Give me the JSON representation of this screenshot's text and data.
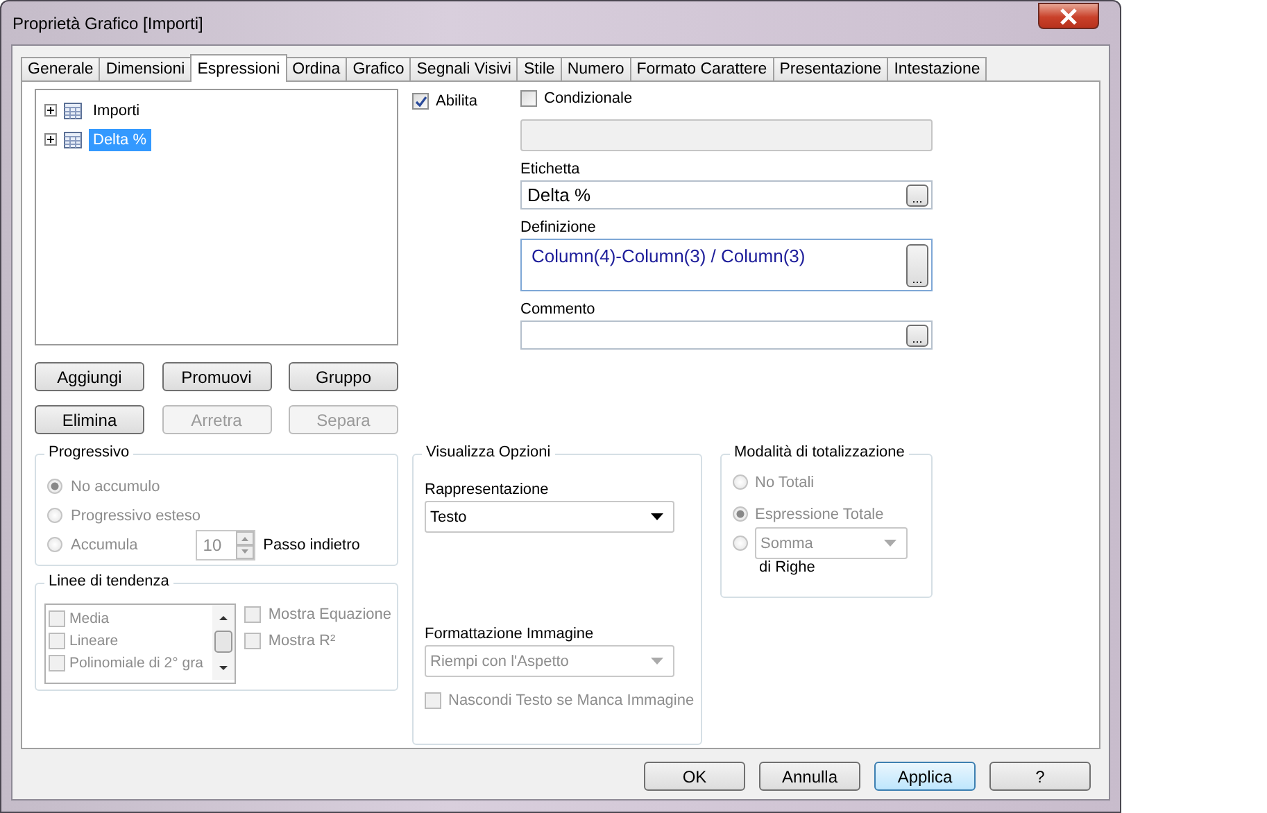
{
  "window": {
    "title": "Proprietà Grafico [Importi]"
  },
  "tabs": [
    {
      "label": "Generale",
      "selected": false
    },
    {
      "label": "Dimensioni",
      "selected": false
    },
    {
      "label": "Espressioni",
      "selected": true
    },
    {
      "label": "Ordina",
      "selected": false
    },
    {
      "label": "Grafico",
      "selected": false
    },
    {
      "label": "Segnali Visivi",
      "selected": false
    },
    {
      "label": "Stile",
      "selected": false
    },
    {
      "label": "Numero",
      "selected": false
    },
    {
      "label": "Formato Carattere",
      "selected": false
    },
    {
      "label": "Presentazione",
      "selected": false
    },
    {
      "label": "Intestazione",
      "selected": false
    }
  ],
  "expressions": [
    {
      "label": "Importi",
      "selected": false
    },
    {
      "label": "Delta %",
      "selected": true
    }
  ],
  "expression_buttons": [
    {
      "label": "Aggiungi",
      "disabled": false
    },
    {
      "label": "Promuovi",
      "disabled": false
    },
    {
      "label": "Gruppo",
      "disabled": false
    },
    {
      "label": "Elimina",
      "disabled": false
    },
    {
      "label": "Arretra",
      "disabled": true
    },
    {
      "label": "Separa",
      "disabled": true
    }
  ],
  "enable": {
    "label": "Abilita",
    "checked": true
  },
  "conditional": {
    "label": "Condizionale",
    "checked": false
  },
  "label_field": {
    "label": "Etichetta",
    "value": "Delta %",
    "button": "..."
  },
  "definition": {
    "label": "Definizione",
    "value": "Column(4)-Column(3) / Column(3)",
    "button": "..."
  },
  "comment": {
    "label": "Commento",
    "button": "..."
  },
  "accumulation": {
    "title": "Progressivo",
    "disabled": true,
    "options": [
      {
        "label": "No accumulo",
        "selected": true
      },
      {
        "label": "Progressivo esteso",
        "selected": false
      },
      {
        "label": "Accumula",
        "selected": false
      }
    ],
    "steps": "10",
    "steps_label": "Passo indietro"
  },
  "trendlines": {
    "title": "Linee di tendenza",
    "disabled": true,
    "items": [
      {
        "label": "Media",
        "checked": false
      },
      {
        "label": "Lineare",
        "checked": false
      },
      {
        "label": "Polinomiale di 2° gra",
        "checked": false
      }
    ],
    "options": [
      {
        "label": "Mostra Equazione",
        "checked": false
      },
      {
        "label": "Mostra R²",
        "checked": false
      }
    ]
  },
  "display": {
    "title": "Visualizza Opzioni",
    "representation_label": "Rappresentazione",
    "representation": "Testo",
    "image_format_label": "Formattazione Immagine",
    "image_format": "Riempi con l'Aspetto",
    "image_format_disabled": true,
    "hide_text": {
      "label": "Nascondi Testo se Manca Immagine",
      "checked": false,
      "disabled": true
    }
  },
  "totals": {
    "title": "Modalità di totalizzazione",
    "disabled": true,
    "options": [
      {
        "kind": "label",
        "label": "No Totali",
        "selected": false
      },
      {
        "kind": "label",
        "label": "Espressione Totale",
        "selected": true
      },
      {
        "kind": "dropdown",
        "label": "Somma",
        "selected": false
      }
    ],
    "suffix": "di Righe"
  },
  "buttons": [
    {
      "label": "OK",
      "focused": false
    },
    {
      "label": "Annulla",
      "focused": false
    },
    {
      "label": "Applica",
      "focused": true
    },
    {
      "label": "?",
      "focused": false
    }
  ]
}
